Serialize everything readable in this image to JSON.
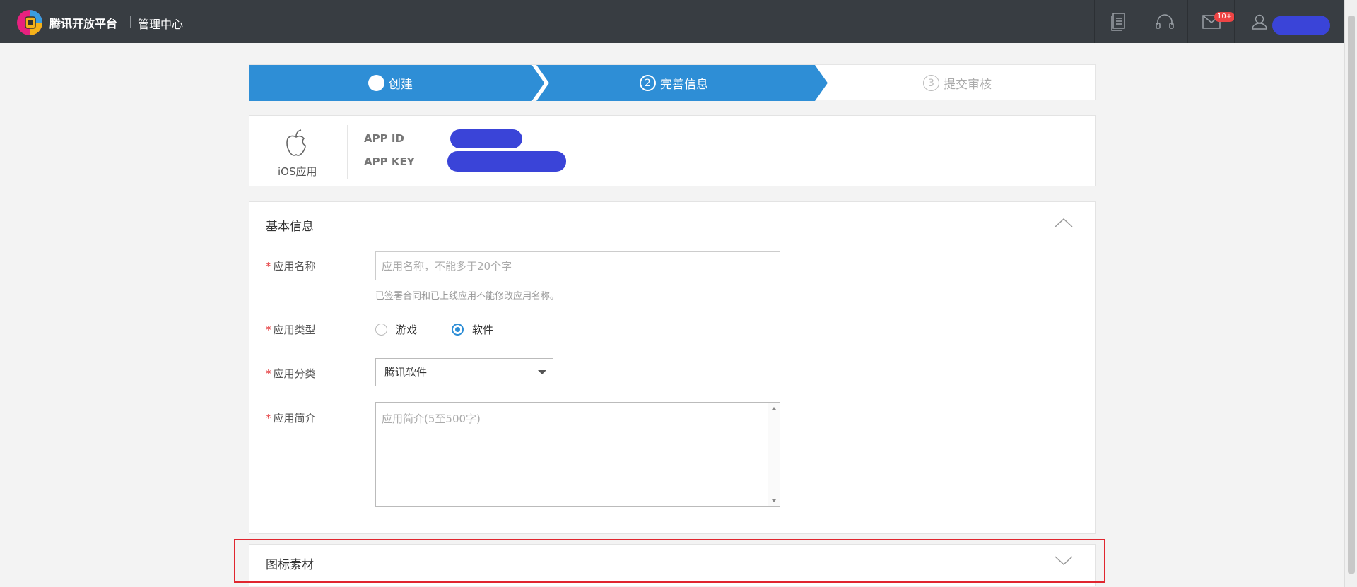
{
  "header": {
    "brand": "腾讯开放平台",
    "sub_brand": "管理中心",
    "message_badge": "10+",
    "icons": [
      "doc-icon",
      "headset-icon",
      "mail-icon",
      "user-icon"
    ]
  },
  "steps": [
    {
      "label": "创建",
      "state": "done",
      "number": ""
    },
    {
      "label": "完善信息",
      "state": "active",
      "number": "2"
    },
    {
      "label": "提交审核",
      "state": "pending",
      "number": "3"
    }
  ],
  "app": {
    "type_label": "iOS应用",
    "app_id_label": "APP ID",
    "app_key_label": "APP KEY"
  },
  "basic_info": {
    "title": "基本信息",
    "name_label": "应用名称",
    "name_placeholder": "应用名称，不能多于20个字",
    "name_hint": "已签署合同和已上线应用不能修改应用名称。",
    "type_label": "应用类型",
    "type_options": [
      "游戏",
      "软件"
    ],
    "type_selected": "软件",
    "category_label": "应用分类",
    "category_value": "腾讯软件",
    "intro_label": "应用简介",
    "intro_placeholder": "应用简介(5至500字)"
  },
  "icon_material": {
    "title": "图标素材"
  },
  "colors": {
    "topbar": "#383d42",
    "step_active": "#2e8ed6",
    "required": "#e4393c",
    "highlight": "#e0262f"
  }
}
